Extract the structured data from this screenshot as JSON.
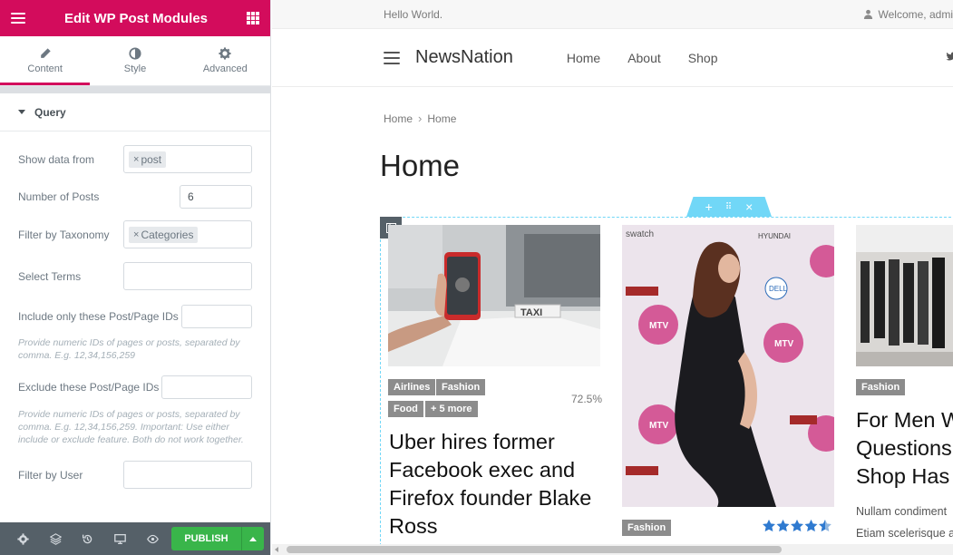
{
  "panel": {
    "title": "Edit WP Post Modules",
    "tabs": [
      {
        "label": "Content",
        "icon": "pencil-icon"
      },
      {
        "label": "Style",
        "icon": "half-circle-icon"
      },
      {
        "label": "Advanced",
        "icon": "gear-icon"
      }
    ],
    "section_title": "Query",
    "controls": {
      "show_data_from": {
        "label": "Show data from",
        "chip": "post"
      },
      "number_of_posts": {
        "label": "Number of Posts",
        "value": "6"
      },
      "filter_by_taxonomy": {
        "label": "Filter by Taxonomy",
        "chip": "Categories"
      },
      "select_terms": {
        "label": "Select Terms",
        "value": ""
      },
      "include_ids": {
        "label": "Include only these Post/Page IDs",
        "value": "",
        "hint": "Provide numeric IDs of pages or posts, separated by comma. E.g. 12,34,156,259"
      },
      "exclude_ids": {
        "label": "Exclude these Post/Page IDs",
        "value": "",
        "hint": "Provide numeric IDs of pages or posts, separated by comma. E.g. 12,34,156,259. Important: Use either include or exclude feature. Both do not work together."
      },
      "filter_by_user": {
        "label": "Filter by User",
        "value": ""
      }
    },
    "footer": {
      "publish_label": "PUBLISH"
    }
  },
  "site": {
    "topbar_left": "Hello World.",
    "topbar_right": "Welcome, admi",
    "brand": "NewsNation",
    "menu": [
      "Home",
      "About",
      "Shop"
    ],
    "breadcrumb": [
      "Home",
      "Home"
    ],
    "page_title": "Home"
  },
  "posts": [
    {
      "tags": [
        "Airlines",
        "Fashion",
        "Food",
        "+ 5 more"
      ],
      "score": "72.5%",
      "title_lines": [
        "Uber hires former",
        "Facebook exec and",
        "Firefox founder Blake",
        "Ross"
      ]
    },
    {
      "tags": [
        "Fashion"
      ],
      "rating": 4.5
    },
    {
      "tags": [
        "Fashion"
      ],
      "title_lines": [
        "For Men W",
        "Questions",
        "Shop Has"
      ],
      "excerpt_lines": [
        "Nullam condiment",
        "Etiam scelerisque a"
      ]
    }
  ],
  "colors": {
    "brand": "#d30c5c",
    "publish": "#39b54a",
    "handle": "#71d7f7",
    "star": "#2f7ad0"
  }
}
